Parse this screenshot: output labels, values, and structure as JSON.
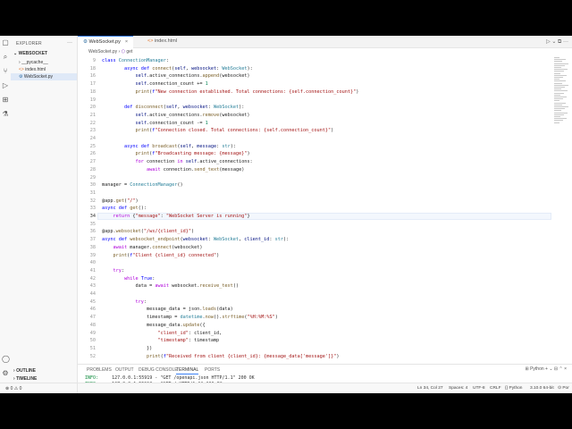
{
  "sidebar": {
    "title": "EXPLORER",
    "more": "···",
    "project": "WEBSOCKET",
    "items": [
      {
        "label": "__pycache__",
        "prefix": "›"
      },
      {
        "label": "index.html",
        "prefix": "<>"
      },
      {
        "label": "WebSocket.py",
        "prefix": "⚙"
      }
    ],
    "outline": "OUTLINE",
    "timeline": "TIMELINE",
    "problems_status": "⊗ 0 ⚠ 0"
  },
  "tabs": [
    {
      "label": "WebSocket.py",
      "close": "×"
    },
    {
      "label": "index.html"
    }
  ],
  "breadcrumb": {
    "file": "WebSocket.py",
    "symbol": "get"
  },
  "editor": {
    "current_line": 34,
    "lines": [
      {
        "n": 9,
        "html": "<span class='k'>class</span> <span class='t'>ConnectionManager</span>:"
      },
      {
        "n": 18,
        "html": "        <span class='k'>async def</span> <span class='f'>connect</span>(<span class='v'>self</span>, <span class='v'>websocket</span>: <span class='t'>WebSocket</span>):"
      },
      {
        "n": 16,
        "html": "            <span class='v'>self</span>.active_connections.<span class='f'>append</span>(websocket)"
      },
      {
        "n": 17,
        "html": "            <span class='v'>self</span>.connection_count += <span class='n'>1</span>"
      },
      {
        "n": 18,
        "html": "            <span class='f'>print</span>(<span class='k'>f</span><span class='s'>\"New connection established. Total connections: {self.connection_count}\"</span>)"
      },
      {
        "n": 19,
        "html": ""
      },
      {
        "n": 20,
        "html": "        <span class='k'>def</span> <span class='f'>disconnect</span>(<span class='v'>self</span>, <span class='v'>websocket</span>: <span class='t'>WebSocket</span>):"
      },
      {
        "n": 21,
        "html": "            <span class='v'>self</span>.active_connections.<span class='f'>remove</span>(websocket)"
      },
      {
        "n": 22,
        "html": "            <span class='v'>self</span>.connection_count -= <span class='n'>1</span>"
      },
      {
        "n": 23,
        "html": "            <span class='f'>print</span>(<span class='k'>f</span><span class='s'>\"Connection closed. Total connections: {self.connection_count}\"</span>)"
      },
      {
        "n": 24,
        "html": ""
      },
      {
        "n": 25,
        "html": "        <span class='k'>async def</span> <span class='f'>broadcast</span>(<span class='v'>self</span>, <span class='v'>message</span>: <span class='t'>str</span>):"
      },
      {
        "n": 26,
        "html": "            <span class='f'>print</span>(<span class='k'>f</span><span class='s'>\"Broadcasting message: {message}\"</span>)"
      },
      {
        "n": 27,
        "html": "            <span class='c'>for</span> connection <span class='c'>in</span> <span class='v'>self</span>.active_connections:"
      },
      {
        "n": 28,
        "html": "                <span class='c'>await</span> connection.<span class='f'>send_text</span>(message)"
      },
      {
        "n": 29,
        "html": ""
      },
      {
        "n": 30,
        "html": "manager = <span class='t'>ConnectionManager</span>()"
      },
      {
        "n": 31,
        "html": ""
      },
      {
        "n": 32,
        "html": "@app.<span class='f'>get</span>(<span class='s'>\"/\"</span>)"
      },
      {
        "n": 33,
        "html": "<span class='k'>async def</span> <span class='f'>get</span>():"
      },
      {
        "n": 34,
        "html": "    <span class='c'>return</span> {<span class='s'>\"message\"</span>: <span class='s'>\"WebSocket Server is running\"</span>}"
      },
      {
        "n": 35,
        "html": ""
      },
      {
        "n": 36,
        "html": "@app.<span class='f'>websocket</span>(<span class='s'>\"/ws/{client_id}\"</span>)"
      },
      {
        "n": 37,
        "html": "<span class='k'>async def</span> <span class='f'>websocket_endpoint</span>(<span class='v'>websocket</span>: <span class='t'>WebSocket</span>, <span class='v'>client_id</span>: <span class='t'>str</span>):"
      },
      {
        "n": 38,
        "html": "    <span class='c'>await</span> manager.<span class='f'>connect</span>(websocket)"
      },
      {
        "n": 39,
        "html": "    <span class='f'>print</span>(<span class='k'>f</span><span class='s'>\"Client {client_id} connected\"</span>)"
      },
      {
        "n": 40,
        "html": ""
      },
      {
        "n": 41,
        "html": "    <span class='c'>try</span>:"
      },
      {
        "n": 42,
        "html": "        <span class='c'>while</span> <span class='k'>True</span>:"
      },
      {
        "n": 43,
        "html": "            data = <span class='c'>await</span> websocket.<span class='f'>receive_text</span>()"
      },
      {
        "n": 44,
        "html": ""
      },
      {
        "n": 45,
        "html": "            <span class='c'>try</span>:"
      },
      {
        "n": 46,
        "html": "                message_data = json.<span class='f'>loads</span>(data)"
      },
      {
        "n": 47,
        "html": "                timestamp = <span class='t'>datetime</span>.<span class='f'>now</span>().<span class='f'>strftime</span>(<span class='s'>\"%H:%M:%S\"</span>)"
      },
      {
        "n": 48,
        "html": "                message_data.<span class='f'>update</span>({"
      },
      {
        "n": 49,
        "html": "                    <span class='s'>\"client_id\"</span>: client_id,"
      },
      {
        "n": 50,
        "html": "                    <span class='s'>\"timestamp\"</span>: timestamp"
      },
      {
        "n": 51,
        "html": "                })"
      },
      {
        "n": 52,
        "html": "                <span class='f'>print</span>(<span class='k'>f</span><span class='s'>\"Received from client {client_id}: {message_data['message']}\"</span>)"
      }
    ]
  },
  "panel": {
    "tabs": [
      "PROBLEMS",
      "OUTPUT",
      "DEBUG CONSOLE",
      "TERMINAL",
      "PORTS"
    ],
    "active_tab": "TERMINAL",
    "right": "⊞ Python  + ⌄ ⊟ ⌃ ×",
    "terminal": [
      "INFO:     127.0.0.1:55919 - \"GET /openapi.json HTTP/1.1\" 200 OK",
      "INFO:     127.0.0.1:55918 - \"GET / HTTP/1.1\" 200 OK",
      "INFO:     ('127.0.0.1', 55923) - \"WebSocket /ws/1soe0u\" [accepted]",
      "New connection established. Total connections: 1",
      "Client 1soe0u connected",
      "INFO:     connection open"
    ]
  },
  "status": {
    "position": "Ln 34, Col 27",
    "spaces": "Spaces: 4",
    "encoding": "UTF-8",
    "eol": "CRLF",
    "language": "{} Python",
    "interpreter": "3.10.0 64-bit",
    "port": "⊙ Por"
  },
  "colors": {
    "accent": "#3b82f6",
    "info_green": "#0a8a3a"
  }
}
